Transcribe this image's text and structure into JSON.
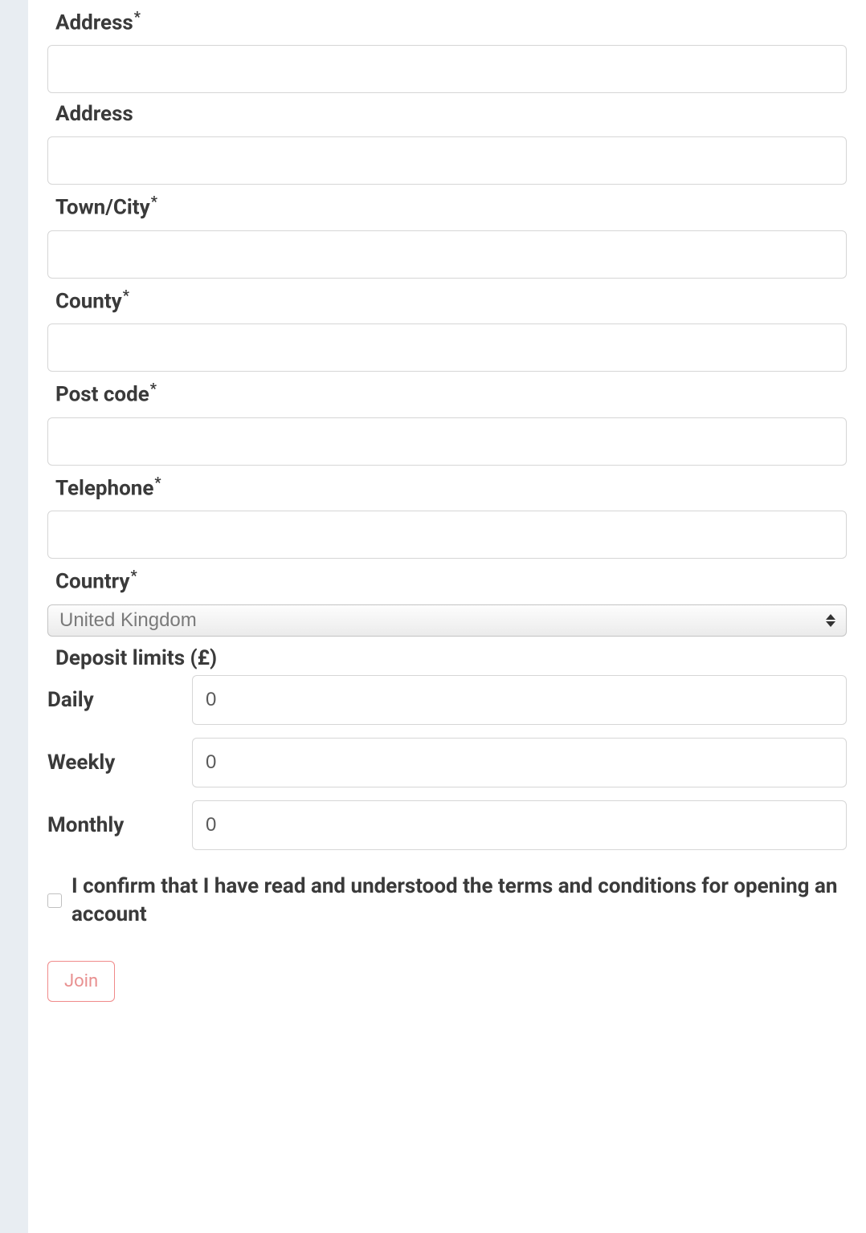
{
  "form": {
    "address1": {
      "label": "Address",
      "required": "*",
      "value": ""
    },
    "address2": {
      "label": "Address",
      "value": ""
    },
    "town_city": {
      "label": "Town/City",
      "required": "*",
      "value": ""
    },
    "county": {
      "label": "County",
      "required": "*",
      "value": ""
    },
    "postcode": {
      "label": "Post code",
      "required": "*",
      "value": ""
    },
    "telephone": {
      "label": "Telephone",
      "required": "*",
      "value": ""
    },
    "country": {
      "label": "Country",
      "required": "*",
      "selected": "United Kingdom"
    }
  },
  "deposit_limits": {
    "heading": "Deposit limits (£)",
    "daily": {
      "label": "Daily",
      "value": "0"
    },
    "weekly": {
      "label": "Weekly",
      "value": "0"
    },
    "monthly": {
      "label": "Monthly",
      "value": "0"
    }
  },
  "terms": {
    "label": "I confirm that I have read and understood the terms and conditions for opening an account",
    "checked": false
  },
  "actions": {
    "join_label": "Join"
  }
}
